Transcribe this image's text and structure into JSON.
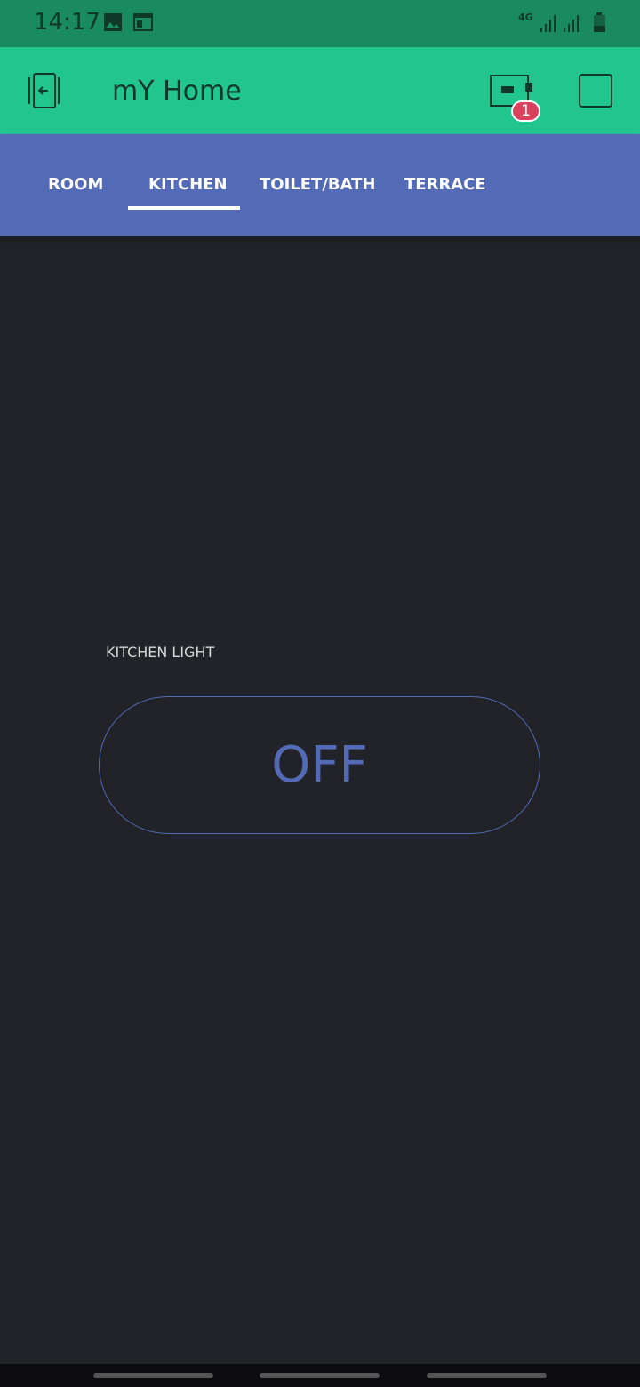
{
  "status_bar": {
    "time": "14:17",
    "network": "4G"
  },
  "app_bar": {
    "title": "mY Home",
    "badge_count": "1"
  },
  "tabs": [
    {
      "label": "ROOM"
    },
    {
      "label": "KITCHEN",
      "active": true
    },
    {
      "label": "TOILET/BATH"
    },
    {
      "label": "TERRACE"
    }
  ],
  "widget": {
    "label": "KITCHEN LIGHT",
    "button_state": "OFF"
  },
  "colors": {
    "accent": "#23c58f",
    "tab_bar": "#536bb6",
    "background": "#212329",
    "badge": "#d9415d"
  }
}
